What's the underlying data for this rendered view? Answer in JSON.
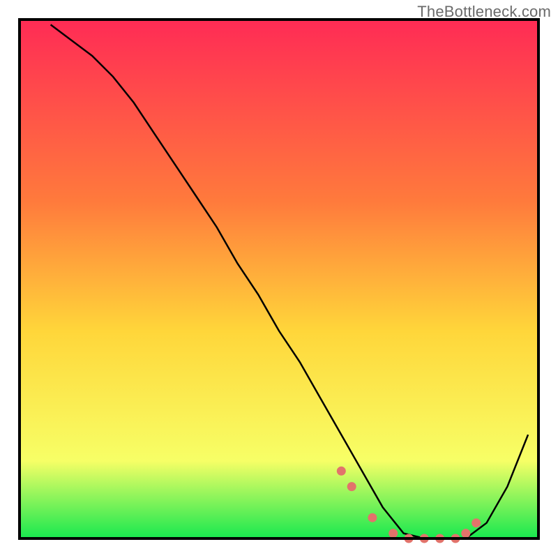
{
  "attribution": "TheBottleneck.com",
  "colors": {
    "gradient_top": "#ff2b55",
    "gradient_mid1": "#ff7a3c",
    "gradient_mid2": "#ffd63a",
    "gradient_mid3": "#f7ff66",
    "gradient_bottom": "#17e84f",
    "frame": "#000000",
    "curve": "#000000",
    "marker": "#e2736b"
  },
  "chart_data": {
    "type": "line",
    "title": "",
    "xlabel": "",
    "ylabel": "",
    "xlim": [
      0,
      100
    ],
    "ylim": [
      0,
      100
    ],
    "series": [
      {
        "name": "bottleneck-curve",
        "x": [
          6,
          10,
          14,
          18,
          22,
          26,
          30,
          34,
          38,
          42,
          46,
          50,
          54,
          58,
          62,
          66,
          70,
          74,
          78,
          82,
          86,
          90,
          94,
          98
        ],
        "y": [
          99,
          96,
          93,
          89,
          84,
          78,
          72,
          66,
          60,
          53,
          47,
          40,
          34,
          27,
          20,
          13,
          6,
          1,
          0,
          0,
          0,
          3,
          10,
          20
        ]
      }
    ],
    "markers": {
      "name": "highlight-points",
      "x": [
        62,
        64,
        68,
        72,
        75,
        78,
        81,
        84,
        86,
        88
      ],
      "y": [
        13,
        10,
        4,
        1,
        0,
        0,
        0,
        0,
        1,
        3
      ]
    },
    "annotations": []
  }
}
